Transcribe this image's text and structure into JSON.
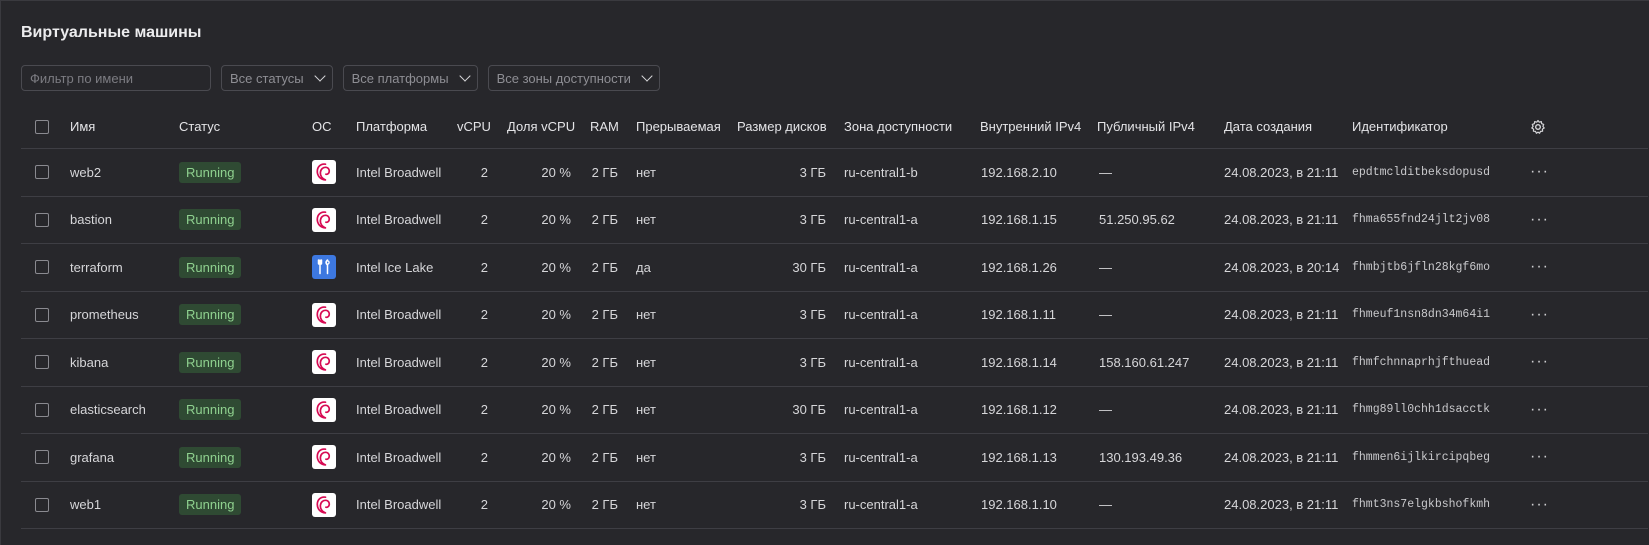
{
  "page": {
    "title": "Виртуальные машины"
  },
  "filters": {
    "name_placeholder": "Фильтр по имени",
    "status": "Все статусы",
    "platform": "Все платформы",
    "zone": "Все зоны доступности"
  },
  "columns": {
    "name": "Имя",
    "status": "Статус",
    "os": "ОС",
    "platform": "Платформа",
    "vcpu": "vCPU",
    "vcpu_share": "Доля vCPU",
    "ram": "RAM",
    "preemptible": "Прерываемая",
    "disk_size": "Размер дисков",
    "zone": "Зона доступности",
    "internal_ip": "Внутренний IPv4",
    "public_ip": "Публичный IPv4",
    "created": "Дата создания",
    "id": "Идентификатор"
  },
  "rows": [
    {
      "name": "web2",
      "status": "Running",
      "os": "debian-icon",
      "platform": "Intel Broadwell",
      "vcpu": "2",
      "vcpu_share": "20 %",
      "ram": "2 ГБ",
      "preemptible": "нет",
      "disk_size": "3 ГБ",
      "zone": "ru-central1-b",
      "internal_ip": "192.168.2.10",
      "public_ip": "—",
      "created": "24.08.2023, в 21:11",
      "id": "epdtmclditbeksdopusd"
    },
    {
      "name": "bastion",
      "status": "Running",
      "os": "debian-icon",
      "platform": "Intel Broadwell",
      "vcpu": "2",
      "vcpu_share": "20 %",
      "ram": "2 ГБ",
      "preemptible": "нет",
      "disk_size": "3 ГБ",
      "zone": "ru-central1-a",
      "internal_ip": "192.168.1.15",
      "public_ip": "51.250.95.62",
      "created": "24.08.2023, в 21:11",
      "id": "fhma655fnd24jlt2jv08"
    },
    {
      "name": "terraform",
      "status": "Running",
      "os": "tools-icon",
      "platform": "Intel Ice Lake",
      "vcpu": "2",
      "vcpu_share": "20 %",
      "ram": "2 ГБ",
      "preemptible": "да",
      "disk_size": "30 ГБ",
      "zone": "ru-central1-a",
      "internal_ip": "192.168.1.26",
      "public_ip": "—",
      "created": "24.08.2023, в 20:14",
      "id": "fhmbjtb6jfln28kgf6mo"
    },
    {
      "name": "prometheus",
      "status": "Running",
      "os": "debian-icon",
      "platform": "Intel Broadwell",
      "vcpu": "2",
      "vcpu_share": "20 %",
      "ram": "2 ГБ",
      "preemptible": "нет",
      "disk_size": "3 ГБ",
      "zone": "ru-central1-a",
      "internal_ip": "192.168.1.11",
      "public_ip": "—",
      "created": "24.08.2023, в 21:11",
      "id": "fhmeuf1nsn8dn34m64i1"
    },
    {
      "name": "kibana",
      "status": "Running",
      "os": "debian-icon",
      "platform": "Intel Broadwell",
      "vcpu": "2",
      "vcpu_share": "20 %",
      "ram": "2 ГБ",
      "preemptible": "нет",
      "disk_size": "3 ГБ",
      "zone": "ru-central1-a",
      "internal_ip": "192.168.1.14",
      "public_ip": "158.160.61.247",
      "created": "24.08.2023, в 21:11",
      "id": "fhmfchnnaprhjfthuead"
    },
    {
      "name": "elasticsearch",
      "status": "Running",
      "os": "debian-icon",
      "platform": "Intel Broadwell",
      "vcpu": "2",
      "vcpu_share": "20 %",
      "ram": "2 ГБ",
      "preemptible": "нет",
      "disk_size": "30 ГБ",
      "zone": "ru-central1-a",
      "internal_ip": "192.168.1.12",
      "public_ip": "—",
      "created": "24.08.2023, в 21:11",
      "id": "fhmg89ll0chh1dsacctk"
    },
    {
      "name": "grafana",
      "status": "Running",
      "os": "debian-icon",
      "platform": "Intel Broadwell",
      "vcpu": "2",
      "vcpu_share": "20 %",
      "ram": "2 ГБ",
      "preemptible": "нет",
      "disk_size": "3 ГБ",
      "zone": "ru-central1-a",
      "internal_ip": "192.168.1.13",
      "public_ip": "130.193.49.36",
      "created": "24.08.2023, в 21:11",
      "id": "fhmmen6ijlkircipqbeg"
    },
    {
      "name": "web1",
      "status": "Running",
      "os": "debian-icon",
      "platform": "Intel Broadwell",
      "vcpu": "2",
      "vcpu_share": "20 %",
      "ram": "2 ГБ",
      "preemptible": "нет",
      "disk_size": "3 ГБ",
      "zone": "ru-central1-a",
      "internal_ip": "192.168.1.10",
      "public_ip": "—",
      "created": "24.08.2023, в 21:11",
      "id": "fhmt3ns7elgkbshofkmh"
    }
  ],
  "colors": {
    "background": "#27272b",
    "running_badge_bg": "#2f4a33",
    "running_badge_text": "#8fd18f",
    "debian_red": "#d70a53"
  }
}
